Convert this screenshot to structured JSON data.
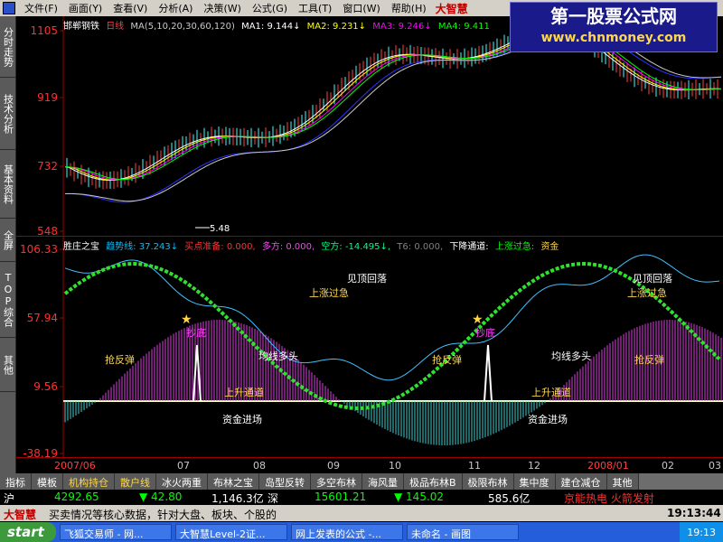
{
  "menu": {
    "items": [
      "文件(F)",
      "画面(Y)",
      "查看(V)",
      "分析(A)",
      "决策(W)",
      "公式(G)",
      "工具(T)",
      "窗口(W)",
      "帮助(H)"
    ],
    "brand": "大智慧"
  },
  "watermark": {
    "title": "第一股票公式网",
    "url": "www.chnmoney.com"
  },
  "side_tabs": [
    "分时走势",
    "技术分析",
    "基本资料",
    "全屏",
    "TOP综合",
    "其他"
  ],
  "main_chart": {
    "stock": "邯郸钢铁",
    "period": "日线",
    "ma_label": "MA(5,10,20,30,60,120)",
    "ma1": "MA1: 9.144↓",
    "ma2": "MA2: 9.231↓",
    "ma3": "MA3: 9.246↓",
    "ma4": "MA4: 9.411",
    "y_ticks": [
      "1105",
      "919",
      "732",
      "548"
    ],
    "low_annotation": "5.48",
    "colors": {
      "ma1": "#ffffff",
      "ma2": "#ffff00",
      "ma3": "#ff00ff",
      "ma4": "#00ff00",
      "ma5": "#3030ff",
      "ma6": "#c8c8c8"
    }
  },
  "indicator": {
    "name": "胜庄之宝",
    "trend": "趋势线: 37.243↓",
    "buy_ready": "买点准备: 0.000,",
    "long": "多方: 0.000,",
    "short": "空方: -14.495↓,",
    "t6": "T6: 0.000,",
    "down_channel": "下降通道:",
    "up_urgent": "上涨过急:",
    "fund": "资金",
    "y_ticks": [
      "106.33",
      "57.94",
      "9.56",
      "-38.19"
    ],
    "labels": {
      "rebound": "抢反弹",
      "bottom": "抄底",
      "ma_bull": "均线多头",
      "up_channel": "上升通道",
      "funds_in": "资金进场",
      "overheat": "上涨过急",
      "top_fall": "见顶回落"
    }
  },
  "date_axis": [
    "2007/06",
    "07",
    "08",
    "09",
    "10",
    "11",
    "12",
    "2008/01",
    "02",
    "03"
  ],
  "bottom_tabs": [
    "指标",
    "模板",
    "机构持仓",
    "散户线",
    "冰火两重",
    "布林之宝",
    "岛型反转",
    "多空布林",
    "海风量",
    "极品布林B",
    "极限布林",
    "集中度",
    "建仓减仓",
    "其他"
  ],
  "quote": {
    "sh_label": "沪",
    "sh_index": "4292.65",
    "sh_change": "▼ 42.80",
    "sh_amount": "1,146.3亿",
    "sz_label": "深",
    "sz_index": "15601.21",
    "sz_change": "▼ 145.02",
    "sz_amount": "585.6亿",
    "news_right": "京能热电 火箭发射"
  },
  "news": {
    "brand": "大智慧",
    "text": "买卖情况等核心数据，针对大盘、板块、个股的",
    "time": "19:13:44"
  },
  "taskbar": {
    "start": "start",
    "tasks": [
      "飞狐交易师 - 网...",
      "大智慧Level-2证...",
      "网上发表的公式 -...",
      "未命名 - 画图"
    ],
    "clock": "19:13"
  }
}
